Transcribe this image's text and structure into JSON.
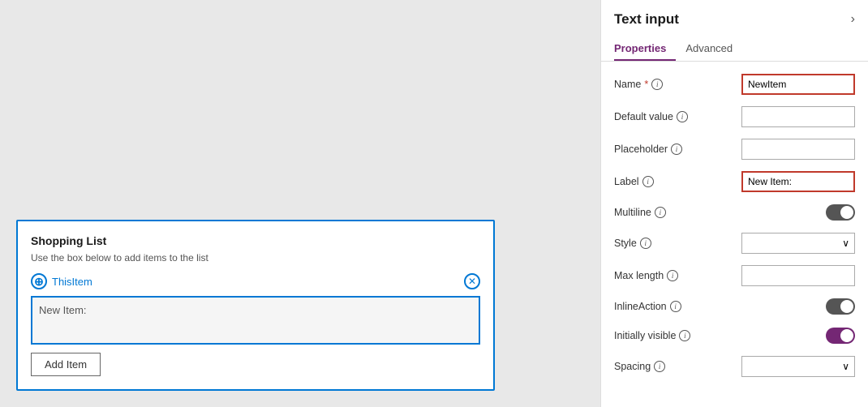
{
  "panel": {
    "title": "Text input",
    "chevron": "›",
    "tabs": [
      {
        "label": "Properties",
        "active": true
      },
      {
        "label": "Advanced",
        "active": false
      }
    ],
    "properties": {
      "name_label": "Name",
      "name_required": "*",
      "name_value": "NewItem",
      "default_value_label": "Default value",
      "default_value_value": "",
      "placeholder_label": "Placeholder",
      "placeholder_value": "",
      "label_label": "Label",
      "label_value": "New Item:",
      "multiline_label": "Multiline",
      "style_label": "Style",
      "max_length_label": "Max length",
      "inline_action_label": "InlineAction",
      "initially_visible_label": "Initially visible",
      "spacing_label": "Spacing"
    }
  },
  "canvas": {
    "card": {
      "title": "Shopping List",
      "subtitle": "Use the box below to add items to the list",
      "this_item_label": "ThisItem",
      "text_input_label": "New Item:",
      "add_button_label": "Add Item"
    }
  }
}
